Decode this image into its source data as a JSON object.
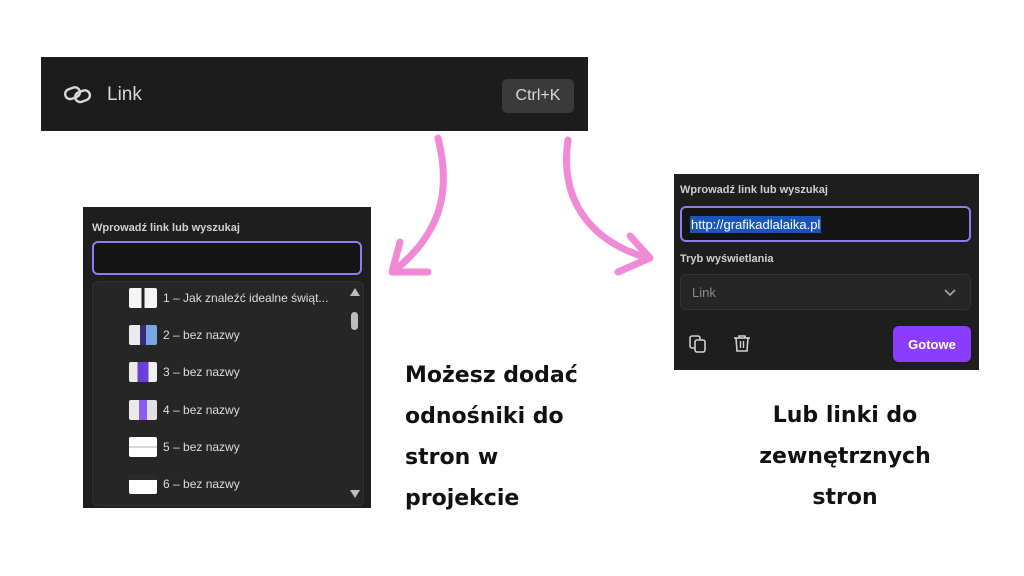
{
  "link_bar": {
    "label": "Link",
    "shortcut": "Ctrl+K"
  },
  "left_panel": {
    "label": "Wprowadź link lub wyszukaj",
    "search_value": "",
    "pages": [
      {
        "text": "1 – Jak znaleźć idealne świąt..."
      },
      {
        "text": "2 – bez nazwy"
      },
      {
        "text": "3 – bez nazwy"
      },
      {
        "text": "4 – bez nazwy"
      },
      {
        "text": "5 – bez nazwy"
      },
      {
        "text": "6 – bez nazwy"
      }
    ]
  },
  "right_panel": {
    "label": "Wprowadź link lub wyszukaj",
    "url_value": "http://grafikadlalaika.pl",
    "mode_label": "Tryb wyświetlania",
    "mode_value": "Link",
    "done_label": "Gotowe"
  },
  "captions": {
    "left": [
      "Możesz dodać",
      "odnośniki do",
      "stron w",
      "projekcie"
    ],
    "right": [
      "Lub linki do",
      "zewnętrznych",
      "stron"
    ]
  },
  "colors": {
    "accent": "#8b3dff",
    "arrow": "#f08ad6",
    "focus_border": "#8e7cf0"
  }
}
